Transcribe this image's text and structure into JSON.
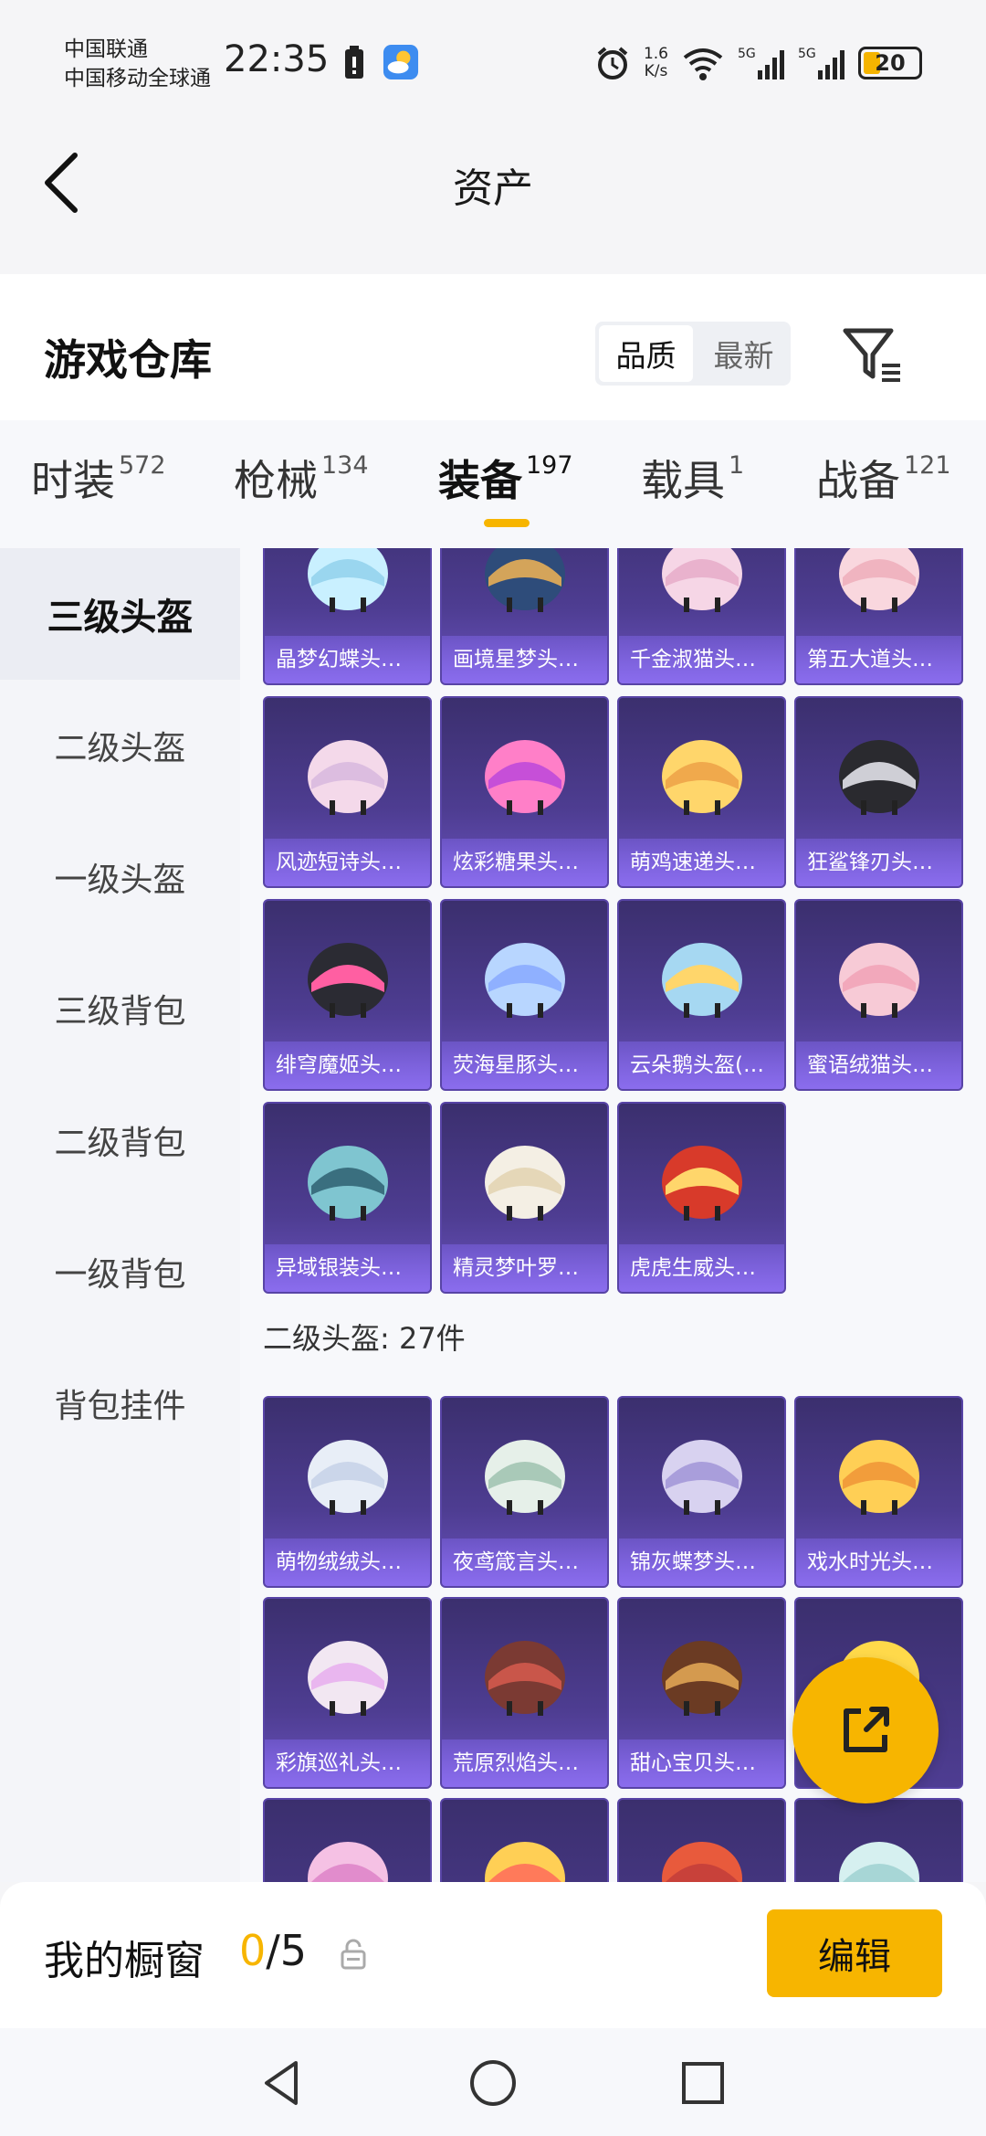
{
  "status_bar": {
    "carrier_1": "中国联通",
    "carrier_2": "中国移动全球通",
    "time": "22:35",
    "net_speed_value": "1.6",
    "net_speed_unit": "K/s",
    "battery_level": "20"
  },
  "nav": {
    "title": "资产"
  },
  "header": {
    "title": "游戏仓库",
    "sort_options": [
      "品质",
      "最新"
    ],
    "active_sort": "品质"
  },
  "tabs": [
    {
      "label": "时装",
      "count": "572"
    },
    {
      "label": "枪械",
      "count": "134"
    },
    {
      "label": "装备",
      "count": "197"
    },
    {
      "label": "载具",
      "count": "1"
    },
    {
      "label": "战备",
      "count": "121"
    }
  ],
  "active_tab": "装备",
  "sidebar": {
    "items": [
      "三级头盔",
      "二级头盔",
      "一级头盔",
      "三级背包",
      "二级背包",
      "一级背包",
      "背包挂件"
    ],
    "active": "三级头盔"
  },
  "sections": [
    {
      "items": [
        "晶梦幻蝶头盔...",
        "画境星梦头盔...",
        "千金淑猫头盔...",
        "第五大道头盔...",
        "风迹短诗头盔...",
        "炫彩糖果头盔...",
        "萌鸡速递头盔...",
        "狂鲨锋刃头盔...",
        "绯穹魔姬头盔...",
        "荧海星豚头盔...",
        "云朵鹅头盔(3...",
        "蜜语绒猫头盔...",
        "异域银装头盔...",
        "精灵梦叶罗丽...",
        "虎虎生威头盔..."
      ]
    },
    {
      "header": "二级头盔: 27件",
      "items": [
        "萌物绒绒头盔...",
        "夜鸢箴言头盔...",
        "锦灰蝶梦头盔...",
        "戏水时光头盔...",
        "彩旗巡礼头盔...",
        "荒原烈焰头盔...",
        "甜心宝贝头盔...",
        "",
        "",
        "",
        "",
        ""
      ]
    }
  ],
  "showcase": {
    "label": "我的橱窗",
    "current": "0",
    "total": "/5",
    "edit_label": "编辑"
  },
  "colors": {
    "accent": "#f7b500",
    "card_bg": "#4e3d92"
  }
}
